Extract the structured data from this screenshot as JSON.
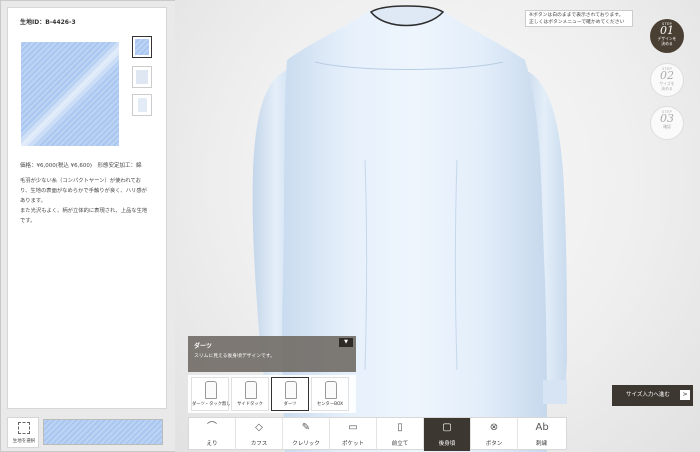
{
  "left_panel": {
    "fabric_id": "生地ID：B-4426-3",
    "price": "価格：¥6,000(税込 ¥6,600)　形態安定加工：綿",
    "description": [
      "毛羽が少ない糸（コンパクトヤーン）が使われてお",
      "り、生地の表面がなめらかで手触りが良く、ハリ感が",
      "あります。",
      "また光沢もよく、柄が立体的に表現され、上品な生地",
      "です。"
    ],
    "fabric_select_label": "生地を選択"
  },
  "notice": {
    "line1": "※ボタンは白のままで表示されております。",
    "line2": "正しくはボタンメニューで確かめてください"
  },
  "steps": [
    {
      "step": "STEP",
      "num": "01",
      "label1": "デザインを",
      "label2": "決める"
    },
    {
      "step": "STEP",
      "num": "02",
      "label1": "サイズを",
      "label2": "決める"
    },
    {
      "step": "STEP",
      "num": "03",
      "label1": "確認",
      "label2": ""
    }
  ],
  "option_panel": {
    "title": "ダーツ",
    "subtitle": "スリムに見える後身頃デザインです。",
    "toggle": "▼",
    "items": [
      {
        "label": "ダーツ・タック無し"
      },
      {
        "label": "サイドタック"
      },
      {
        "label": "ダーツ"
      },
      {
        "label": "センターBOX"
      }
    ]
  },
  "size_button": {
    "label": "サイズ入力へ進む",
    "arrow": ">"
  },
  "bottom_nav": [
    {
      "label": "えり",
      "icon": "⌒"
    },
    {
      "label": "カフス",
      "icon": "◇"
    },
    {
      "label": "クレリック",
      "icon": "✎"
    },
    {
      "label": "ポケット",
      "icon": "▭"
    },
    {
      "label": "前立て",
      "icon": "▯"
    },
    {
      "label": "後身頃",
      "icon": "▢"
    },
    {
      "label": "ボタン",
      "icon": "⊗"
    },
    {
      "label": "刺繍",
      "icon": "Ab"
    }
  ],
  "colors": {
    "accent_dark": "#3c3731",
    "fabric_blue": "#b3ccf2"
  }
}
